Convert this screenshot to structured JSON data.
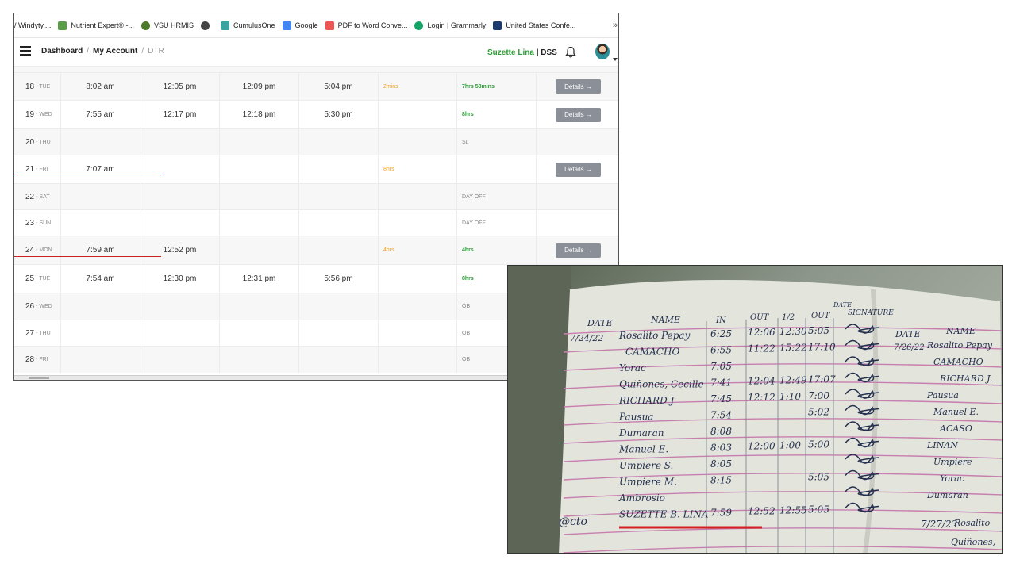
{
  "bookmarks": [
    {
      "label": "/ Windyty,...",
      "icon": "none"
    },
    {
      "label": "Nutrient Expert® -...",
      "icon": "plant-icon"
    },
    {
      "label": "VSU HRMIS",
      "icon": "seal-icon"
    },
    {
      "label": "",
      "icon": "globe-icon"
    },
    {
      "label": "CumulusOne",
      "icon": "cloud-icon"
    },
    {
      "label": "Google",
      "icon": "google-icon"
    },
    {
      "label": "PDF to Word Conve...",
      "icon": "pdf-icon"
    },
    {
      "label": "Login | Grammarly",
      "icon": "grammarly-icon"
    },
    {
      "label": "United States Confe...",
      "icon": "conference-icon"
    }
  ],
  "bookmarks_overflow": "»",
  "breadcrumb": {
    "item1": "Dashboard",
    "item2": "My Account",
    "current": "DTR",
    "sep": "/"
  },
  "user": {
    "name": "Suzette Lina",
    "separator": "|",
    "dept": "DSS"
  },
  "dtr_rows": [
    {
      "day": "18",
      "weekday": "TUE",
      "in_am": "8:02 am",
      "out_am": "12:05 pm",
      "in_pm": "12:09 pm",
      "out_pm": "5:04 pm",
      "late": "2mins",
      "total": "7hrs 58mins",
      "total_style": "good",
      "action": "Details →"
    },
    {
      "day": "19",
      "weekday": "WED",
      "in_am": "7:55 am",
      "out_am": "12:17 pm",
      "in_pm": "12:18 pm",
      "out_pm": "5:30 pm",
      "late": "",
      "total": "8hrs",
      "total_style": "good",
      "action": "Details →"
    },
    {
      "day": "20",
      "weekday": "THU",
      "in_am": "",
      "out_am": "",
      "in_pm": "",
      "out_pm": "",
      "late": "",
      "total": "SL",
      "total_style": "muted",
      "action": ""
    },
    {
      "day": "21",
      "weekday": "FRI",
      "in_am": "7:07 am",
      "out_am": "",
      "in_pm": "",
      "out_pm": "",
      "late": "8hrs",
      "total": "",
      "total_style": "good",
      "action": "Details →"
    },
    {
      "day": "22",
      "weekday": "SAT",
      "in_am": "",
      "out_am": "",
      "in_pm": "",
      "out_pm": "",
      "late": "",
      "total": "DAY OFF",
      "total_style": "muted",
      "action": ""
    },
    {
      "day": "23",
      "weekday": "SUN",
      "in_am": "",
      "out_am": "",
      "in_pm": "",
      "out_pm": "",
      "late": "",
      "total": "DAY OFF",
      "total_style": "muted",
      "action": ""
    },
    {
      "day": "24",
      "weekday": "MON",
      "in_am": "7:59 am",
      "out_am": "12:52 pm",
      "in_pm": "",
      "out_pm": "",
      "late": "4hrs",
      "total": "4hrs",
      "total_style": "good",
      "action": "Details →"
    },
    {
      "day": "25",
      "weekday": "TUE",
      "in_am": "7:54 am",
      "out_am": "12:30 pm",
      "in_pm": "12:31 pm",
      "out_pm": "5:56 pm",
      "late": "",
      "total": "8hrs",
      "total_style": "good",
      "action": ""
    },
    {
      "day": "26",
      "weekday": "WED",
      "in_am": "",
      "out_am": "",
      "in_pm": "",
      "out_pm": "",
      "late": "",
      "total": "OB",
      "total_style": "muted",
      "action": ""
    },
    {
      "day": "27",
      "weekday": "THU",
      "in_am": "",
      "out_am": "",
      "in_pm": "",
      "out_pm": "",
      "late": "",
      "total": "OB",
      "total_style": "muted",
      "action": ""
    },
    {
      "day": "28",
      "weekday": "FRI",
      "in_am": "",
      "out_am": "",
      "in_pm": "",
      "out_pm": "",
      "late": "",
      "total": "OB",
      "total_style": "muted",
      "action": ""
    }
  ],
  "logbook": {
    "headers": {
      "date": "DATE",
      "name": "NAME",
      "in": "IN",
      "out": "OUT",
      "in2": "1/2",
      "out2": "OUT",
      "signature": "SIGNATURE",
      "date_top": "DATE"
    },
    "right_page_headers": {
      "date": "DATE",
      "name": "NAME"
    },
    "date_left": "7/24/22",
    "date_right": "7/26/22",
    "date_right2": "7/27/23",
    "prefix": "@cto",
    "entries": [
      {
        "name": "Rosalito Pepay",
        "t1": "6:25",
        "t2": "12:06",
        "t3": "12:30",
        "t4": "5:05"
      },
      {
        "name": "CAMACHO",
        "t1": "6:55",
        "t2": "11:22",
        "t3": "15:22",
        "t4": "17:10"
      },
      {
        "name": "Yorac",
        "t1": "7:05",
        "t2": "",
        "t3": "",
        "t4": ""
      },
      {
        "name": "Quiñones, Cecille",
        "t1": "7:41",
        "t2": "12:04",
        "t3": "12:49",
        "t4": "17:07"
      },
      {
        "name": "RICHARD J",
        "t1": "7:45",
        "t2": "12:12",
        "t3": "1:10",
        "t4": "7:00"
      },
      {
        "name": "Pausua",
        "t1": "7:54",
        "t2": "",
        "t3": "",
        "t4": "5:02"
      },
      {
        "name": "Dumaran",
        "t1": "8:08",
        "t2": "",
        "t3": "",
        "t4": ""
      },
      {
        "name": "Manuel E.",
        "t1": "8:03",
        "t2": "12:00",
        "t3": "1:00",
        "t4": "5:00"
      },
      {
        "name": "Umpiere S.",
        "t1": "8:05",
        "t2": "",
        "t3": "",
        "t4": ""
      },
      {
        "name": "Umpiere M.",
        "t1": "8:15",
        "t2": "",
        "t3": "",
        "t4": "5:05"
      },
      {
        "name": "Ambrosio",
        "t1": "",
        "t2": "",
        "t3": "",
        "t4": ""
      },
      {
        "name": "SUZETTE B. LINA",
        "t1": "7:59",
        "t2": "12:52",
        "t3": "12:55",
        "t4": "5:05"
      }
    ],
    "right_page_names": [
      "Rosalito Pepay",
      "CAMACHO",
      "RICHARD J.",
      "Pausua",
      "Manuel E.",
      "ACASO",
      "LINAN",
      "Umpiere",
      "Yorac",
      "Dumaran",
      "Rosalito",
      "Quiñones,"
    ]
  },
  "colors": {
    "accent_green": "#2e9c3a",
    "late_orange": "#f0a020",
    "underline_red": "#cc1f1f",
    "button_gray": "#8a8f98"
  }
}
